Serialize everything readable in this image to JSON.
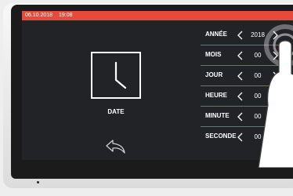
{
  "status": {
    "date": "06.10.2018",
    "time": "19:08"
  },
  "panel": {
    "date_label": "DATE",
    "clock_icon": "clock-icon",
    "back_icon": "back-arrow-icon"
  },
  "rows": [
    {
      "label": "ANNÉE",
      "value": "2018"
    },
    {
      "label": "MOIS",
      "value": "00"
    },
    {
      "label": "JOUR",
      "value": "00"
    },
    {
      "label": "HEURE",
      "value": "00"
    },
    {
      "label": "MINUTE",
      "value": "00"
    },
    {
      "label": "SECONDE",
      "value": "00"
    }
  ],
  "colors": {
    "accent": "#e74a3d",
    "screen": "#222326",
    "text": "#ffffff"
  }
}
